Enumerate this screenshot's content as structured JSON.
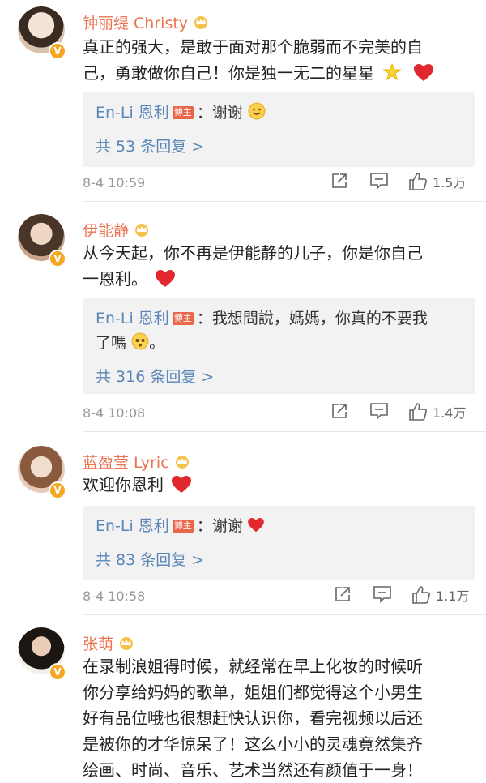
{
  "host_badge": "博主",
  "comments": [
    {
      "name": "钟丽缇 Christy",
      "text_line1": "真正的强大，是敢于面对那个脆弱而不完美的自",
      "text_line2": "己，勇敢做你自己！你是独一无二的星星",
      "text_emojis": [
        "star-emoji",
        "heart-emoji"
      ],
      "reply_author": "En-Li 恩利",
      "reply_text": "：谢谢",
      "reply_more": "共 53 条回复 >",
      "time": "8-4 10:59",
      "likes": "1.5万",
      "avatar_color": "#d9c3b0"
    },
    {
      "name": "伊能静",
      "text_line1": "从今天起，你不再是伊能静的儿子，你是你自己",
      "text_line2": "一恩利。",
      "reply_author": "En-Li 恩利",
      "reply_text_line1": "：我想問說，媽媽，你真的不要我",
      "reply_text_line2": "了嗎",
      "reply_text_line2_tail": "。",
      "reply_more": "共 316 条回复 >",
      "time": "8-4 10:08",
      "likes": "1.4万",
      "avatar_color": "#c9a48b"
    },
    {
      "name": "蓝盈莹 Lyric",
      "text_line1": "欢迎你恩利",
      "reply_author": "En-Li 恩利",
      "reply_text": "：谢谢",
      "reply_more": "共 83 条回复 >",
      "time": "8-4 10:58",
      "likes": "1.1万",
      "avatar_color": "#e6cbb8"
    },
    {
      "name": "张萌",
      "text_lines": [
        "在录制浪姐得时候，就经常在早上化妆的时候听",
        "你分享给妈妈的歌单，姐姐们都觉得这个小男生",
        "好有品位哦也很想赶快认识你，看完视频以后还",
        "是被你的才华惊呆了！这么小小的灵魂竟然集齐",
        "绘画、时尚、音乐、艺术当然还有颜值于一身！"
      ],
      "avatar_color": "#2b2520"
    }
  ],
  "colors": {
    "name": "#eb7350",
    "link": "#5a86b8",
    "reply_bg": "#f2f2f2",
    "host_badge": "#e8674a",
    "verified": "#f5a623",
    "heart": "#e0282e"
  }
}
